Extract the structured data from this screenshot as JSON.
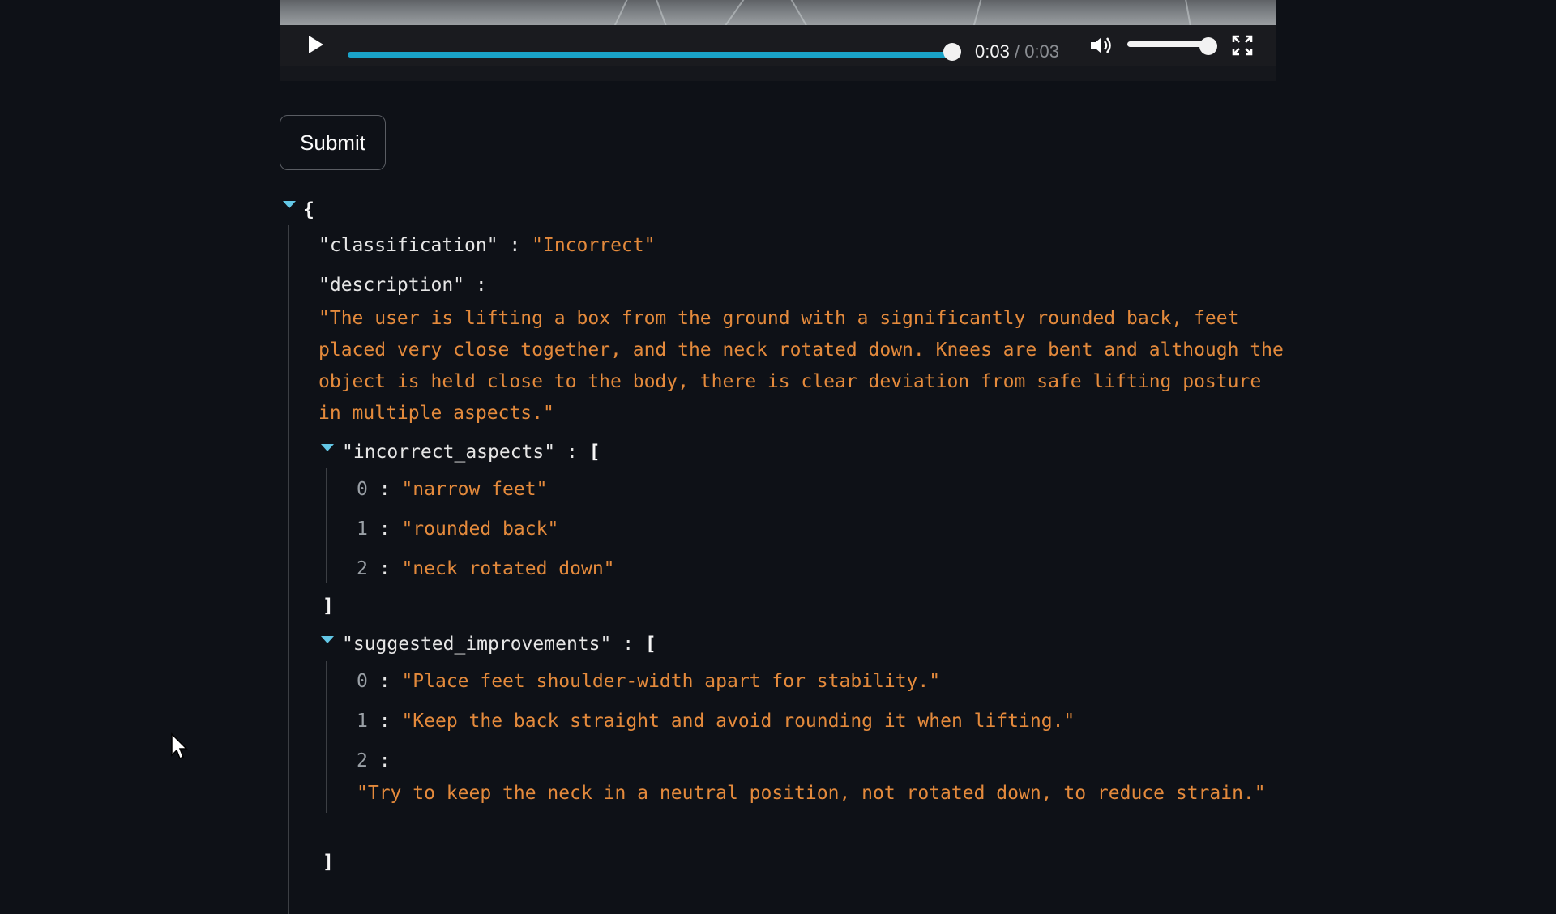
{
  "video": {
    "current_time": "0:03",
    "time_separator": "/",
    "duration": "0:03",
    "progress_fraction": 1.0,
    "volume_fraction": 1.0,
    "icons": {
      "play": "play-icon",
      "volume": "volume-icon",
      "fullscreen": "fullscreen-icon"
    },
    "accent_color": "#1aa3c8"
  },
  "submit": {
    "label": "Submit"
  },
  "json": {
    "open_brace": "{",
    "classification_key": "\"classification\"",
    "classification_value": "\"Incorrect\"",
    "description_key": "\"description\"",
    "description_value": "\"The user is lifting a box from the ground with a significantly rounded back, feet placed very close together, and the neck rotated down. Knees are bent and although the object is held close to the body, there is clear deviation from safe lifting posture in multiple aspects.\"",
    "colon": ":",
    "open_bracket": "[",
    "close_bracket": "]",
    "incorrect_aspects_key": "\"incorrect_aspects\"",
    "incorrect_aspects": [
      {
        "index": "0",
        "value": "\"narrow feet\""
      },
      {
        "index": "1",
        "value": "\"rounded back\""
      },
      {
        "index": "2",
        "value": "\"neck rotated down\""
      }
    ],
    "suggested_improvements_key": "\"suggested_improvements\"",
    "suggested_improvements": [
      {
        "index": "0",
        "value": "\"Place feet shoulder-width apart for stability.\""
      },
      {
        "index": "1",
        "value": "\"Keep the back straight and avoid rounding it when lifting.\""
      },
      {
        "index": "2",
        "value": "\"Try to keep the neck in a neutral position, not rotated down, to reduce strain.\""
      }
    ],
    "string_color": "#e48a3c",
    "caret_color": "#63c7e6"
  }
}
